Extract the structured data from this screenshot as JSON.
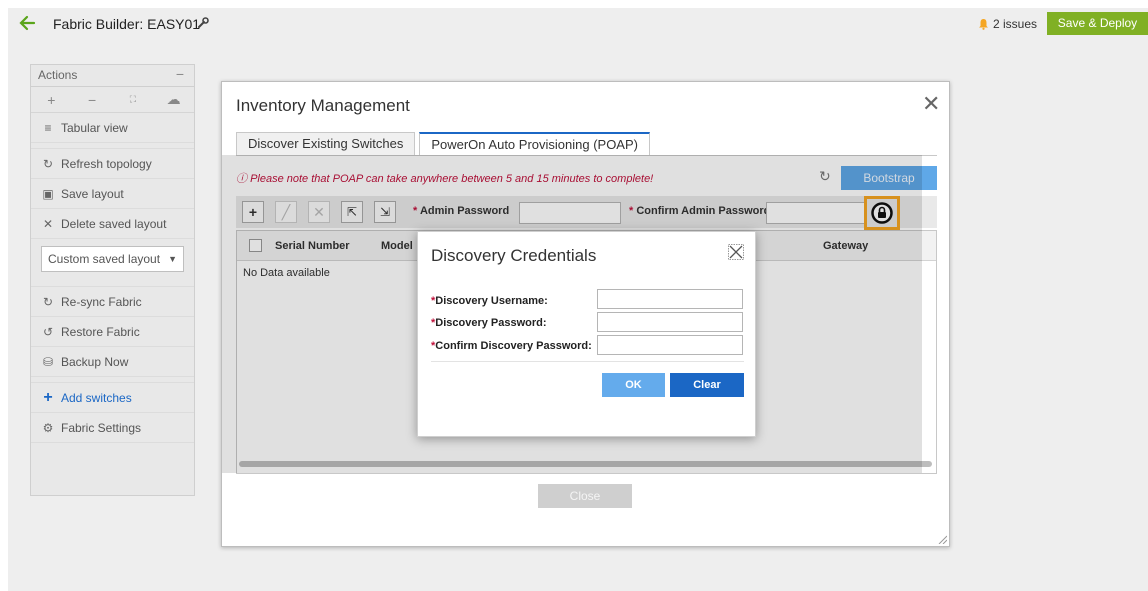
{
  "topbar": {
    "title": "Fabric Builder: EASY01",
    "issues": "2 issues",
    "deploy_label": "Save & Deploy",
    "accent": "#80b024"
  },
  "actions": {
    "header": "Actions",
    "collapse": "−",
    "icon_row": [
      "+",
      "−",
      "⛶",
      "☁"
    ],
    "items": [
      {
        "label": "Tabular view",
        "icon": "list-icon"
      },
      {
        "label": "Refresh topology",
        "icon": "refresh-icon"
      },
      {
        "label": "Save layout",
        "icon": "save-icon"
      },
      {
        "label": "Delete saved layout",
        "icon": "close-icon"
      },
      {
        "label": "Re-sync Fabric",
        "icon": "refresh-icon"
      },
      {
        "label": "Restore Fabric",
        "icon": "restore-icon"
      },
      {
        "label": "Backup Now",
        "icon": "backup-icon"
      },
      {
        "label": "Add switches",
        "icon": "plus-icon"
      },
      {
        "label": "Fabric Settings",
        "icon": "gear-icon"
      }
    ],
    "layout_select": "Custom saved layout"
  },
  "inventory": {
    "title": "Inventory Management",
    "tabs": [
      {
        "label": "Discover Existing Switches",
        "active": false
      },
      {
        "label": "PowerOn Auto Provisioning (POAP)",
        "active": true
      }
    ],
    "note": "Please note that POAP can take anywhere between 5 and 15 minutes to complete!",
    "bootstrap_label": "Bootstrap",
    "admin_password_label": "Admin Password",
    "confirm_admin_password_label": "Confirm Admin Password",
    "admin_password_value": "",
    "confirm_admin_password_value": "",
    "columns": [
      "Serial Number",
      "Model",
      "Gateway"
    ],
    "empty": "No Data available",
    "close_label": "Close"
  },
  "discovery": {
    "title": "Discovery Credentials",
    "fields": [
      {
        "label": "Discovery Username:",
        "value": ""
      },
      {
        "label": "Discovery Password:",
        "value": ""
      },
      {
        "label": "Confirm Discovery Password:",
        "value": ""
      }
    ],
    "ok_label": "OK",
    "clear_label": "Clear"
  }
}
